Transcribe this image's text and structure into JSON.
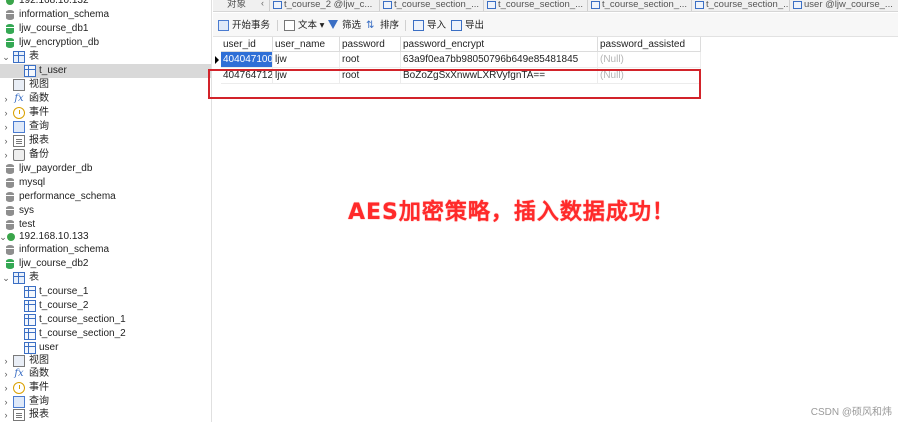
{
  "tree": {
    "items": [
      {
        "label": "192.168.10.132",
        "icon": "connection-icon"
      },
      {
        "label": "information_schema",
        "icon": "database-icon"
      },
      {
        "label": "ljw_course_db1",
        "icon": "database-icon"
      },
      {
        "label": "ljw_encryption_db",
        "icon": "database-icon"
      },
      {
        "label": "表",
        "icon": "table-folder-icon"
      },
      {
        "label": "t_user",
        "icon": "table-icon"
      },
      {
        "label": "视图",
        "icon": "view-icon"
      },
      {
        "label": "函数",
        "icon": "function-icon"
      },
      {
        "label": "事件",
        "icon": "event-icon"
      },
      {
        "label": "查询",
        "icon": "query-icon"
      },
      {
        "label": "报表",
        "icon": "report-icon"
      },
      {
        "label": "备份",
        "icon": "backup-icon"
      },
      {
        "label": "ljw_payorder_db",
        "icon": "database-icon"
      },
      {
        "label": "mysql",
        "icon": "database-icon"
      },
      {
        "label": "performance_schema",
        "icon": "database-icon"
      },
      {
        "label": "sys",
        "icon": "database-icon"
      },
      {
        "label": "test",
        "icon": "database-icon"
      },
      {
        "label": "192.168.10.133",
        "icon": "connection-icon"
      },
      {
        "label": "information_schema",
        "icon": "database-icon"
      },
      {
        "label": "ljw_course_db2",
        "icon": "database-icon"
      },
      {
        "label": "表",
        "icon": "table-folder-icon"
      },
      {
        "label": "t_course_1",
        "icon": "table-icon"
      },
      {
        "label": "t_course_2",
        "icon": "table-icon"
      },
      {
        "label": "t_course_section_1",
        "icon": "table-icon"
      },
      {
        "label": "t_course_section_2",
        "icon": "table-icon"
      },
      {
        "label": "user",
        "icon": "table-icon"
      },
      {
        "label": "视图",
        "icon": "view-icon"
      },
      {
        "label": "函数",
        "icon": "function-icon"
      },
      {
        "label": "事件",
        "icon": "event-icon"
      },
      {
        "label": "查询",
        "icon": "query-icon"
      },
      {
        "label": "报表",
        "icon": "report-icon"
      }
    ]
  },
  "tabs": {
    "objects": "对象",
    "items": [
      "t_course_2 @ljw_c...",
      "t_course_section_...",
      "t_course_section_...",
      "t_course_section_...",
      "t_course_section_...",
      "user @ljw_course_..."
    ]
  },
  "toolbar": {
    "begin_transaction": "开始事务",
    "text": "文本",
    "filter": "筛选",
    "sort": "排序",
    "import": "导入",
    "export": "导出"
  },
  "grid": {
    "columns": [
      "user_id",
      "user_name",
      "password",
      "password_encrypt",
      "password_assisted"
    ],
    "rows": [
      [
        "404047100",
        "ljw",
        "root",
        "63a9f0ea7bb98050796b649e85481845",
        "(Null)"
      ],
      [
        "404764712",
        "ljw",
        "root",
        "BoZoZgSxXnwwLXRVyfgnTA==",
        "(Null)"
      ]
    ]
  },
  "annotation": "AES加密策略，插入数据成功！",
  "watermark": "CSDN @硕风和炜"
}
